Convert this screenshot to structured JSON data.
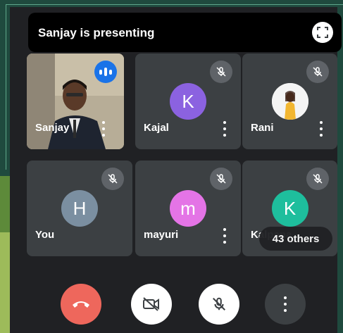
{
  "presenting": {
    "text": "Sanjay is presenting"
  },
  "participants": [
    {
      "name": "Sanjay",
      "type": "video",
      "speaking": true
    },
    {
      "name": "Kajal",
      "initial": "K",
      "avatar_color": "#8b62e0",
      "muted": true
    },
    {
      "name": "Rani",
      "type": "photo",
      "muted": true
    },
    {
      "name": "You",
      "initial": "H",
      "avatar_color": "#7b8fa1",
      "muted": true
    },
    {
      "name": "mayuri",
      "initial": "m",
      "avatar_color": "#e474e6",
      "muted": true
    },
    {
      "name": "Kalpana",
      "initial": "K",
      "avatar_color": "#1ebe9d",
      "muted": true
    }
  ],
  "others": {
    "label": "43 others"
  },
  "controls": {
    "end_call_color": "#ee675c",
    "button_light": "#ffffff",
    "button_dark": "#3c4043"
  },
  "icons": [
    "fullscreen-icon",
    "mic-off-icon",
    "speaking-icon",
    "more-vert-icon",
    "phone-end-icon",
    "video-off-icon"
  ]
}
